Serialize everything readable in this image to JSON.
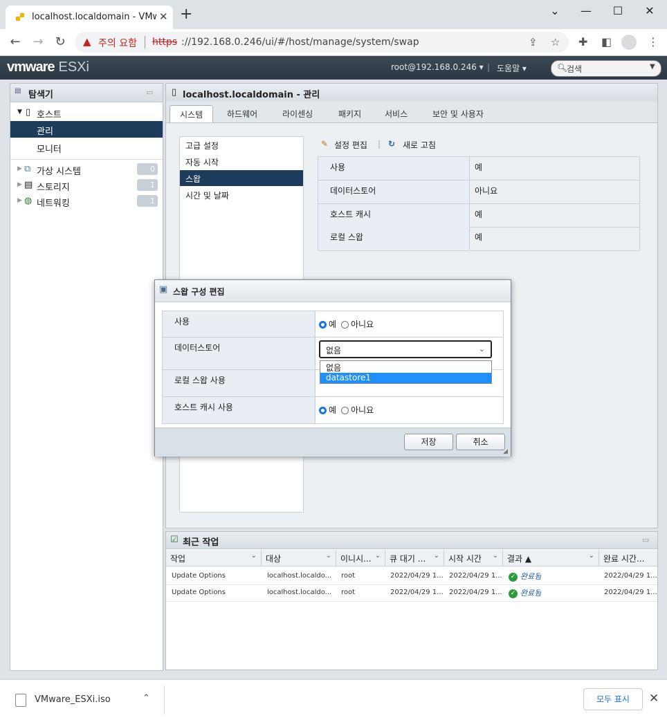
{
  "browser": {
    "tab_title": "localhost.localdomain - VMware ESXi",
    "new_tab": "+",
    "security_warning": "주의 요함",
    "url_scheme": "https",
    "url_rest": "://192.168.0.246/ui/#/host/manage/system/swap"
  },
  "esxi_header": {
    "logo_vm": "vmware",
    "logo_product": "ESXi",
    "user": "root@192.168.0.246 ▾",
    "help": "도움말 ▾",
    "search_placeholder": "검색"
  },
  "navigator": {
    "title": "탐색기",
    "host": "호스트",
    "host_items": [
      "관리",
      "모니터"
    ],
    "groups": [
      {
        "label": "가상 시스템",
        "count": "0"
      },
      {
        "label": "스토리지",
        "count": "1"
      },
      {
        "label": "네트워킹",
        "count": "1"
      }
    ]
  },
  "main": {
    "title": "localhost.localdomain - 관리",
    "tabs": [
      "시스템",
      "하드웨어",
      "라이센싱",
      "패키지",
      "서비스",
      "보안 및 사용자"
    ],
    "subnav": [
      "고급 설정",
      "자동 시작",
      "스왑",
      "시간 및 날짜"
    ],
    "actions": {
      "edit": "설정 편집",
      "refresh": "새로 고침"
    },
    "info": [
      {
        "k": "사용",
        "v": "예"
      },
      {
        "k": "데이터스토어",
        "v": "아니요"
      },
      {
        "k": "호스트 캐시",
        "v": "예"
      },
      {
        "k": "로컬 스왑",
        "v": "예"
      }
    ]
  },
  "modal": {
    "title": "스왑 구성 편집",
    "rows": {
      "enabled": "사용",
      "datastore": "데이터스토어",
      "local_swap": "로컬 스왑 사용",
      "host_cache": "호스트 캐시 사용"
    },
    "yes": "예",
    "no": "아니요",
    "datastore_selected": "없음",
    "datastore_options": [
      "없음",
      "datastore1"
    ],
    "save": "저장",
    "cancel": "취소"
  },
  "tasks": {
    "title": "최근 작업",
    "columns": [
      "작업",
      "대상",
      "이니시...",
      "큐 대기 ...",
      "시작 시간",
      "결과 ▲",
      "완료 시간..."
    ],
    "rows": [
      {
        "task": "Update Options",
        "target": "localhost.localdo...",
        "initiator": "root",
        "queued": "2022/04/29 1...",
        "started": "2022/04/29 1...",
        "result": "완료됨",
        "completed": "2022/04/29 1..."
      },
      {
        "task": "Update Options",
        "target": "localhost.localdo...",
        "initiator": "root",
        "queued": "2022/04/29 1...",
        "started": "2022/04/29 1...",
        "result": "완료됨",
        "completed": "2022/04/29 1..."
      }
    ]
  },
  "download": {
    "filename": "VMware_ESXi.iso",
    "show_all": "모두 표시"
  },
  "colors": {
    "accent": "#1a73e8",
    "selected_nav": "#1d3c5c",
    "warning": "#c5221f",
    "success": "#2e9a3a"
  }
}
